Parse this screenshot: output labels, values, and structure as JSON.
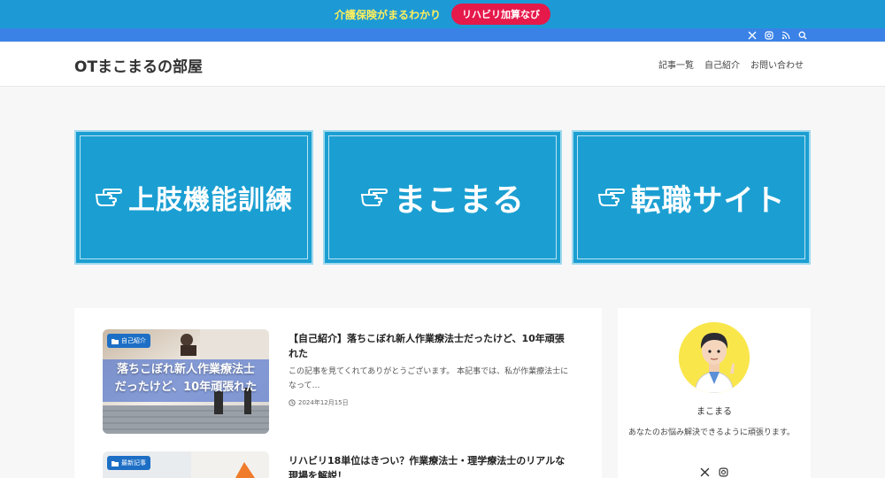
{
  "notice": {
    "text": "介護保険がまるわかり",
    "button": "リハビリ加算なび"
  },
  "topbar": {
    "icons": [
      "x-icon",
      "instagram-icon",
      "rss-icon",
      "search-icon"
    ]
  },
  "header": {
    "site_title": "OTまこまるの部屋",
    "nav": [
      "記事一覧",
      "自己紹介",
      "お問い合わせ"
    ]
  },
  "banners": [
    {
      "label": "上肢機能訓練",
      "icon": "pointing-hand-icon"
    },
    {
      "label": "まこまる",
      "icon": "pointing-hand-icon"
    },
    {
      "label": "転職サイト",
      "icon": "pointing-hand-icon"
    }
  ],
  "posts": [
    {
      "category": "自己紹介",
      "thumb_text": [
        "落ちこぼれ新人作業療法士",
        "だったけど、10年頑張れた"
      ],
      "title": "【自己紹介】落ちこぼれ新人作業療法士だったけど、10年頑張れた",
      "excerpt": "この記事を見てくれてありがとうございます。 本記事では、私が作業療法士になって…",
      "date": "2024年12月15日"
    },
    {
      "category": "最新記事",
      "title": "リハビリ18単位はきつい？作業療法士・理学療法士のリアルな現場を解説！"
    }
  ],
  "profile": {
    "name": "まこまる",
    "description": "あなたのお悩み解決できるように頑張ります。",
    "icons": [
      "x-icon",
      "instagram-icon"
    ]
  },
  "colors": {
    "accent": "#1b9fd2",
    "notice_bg": "#1d9ad6",
    "notice_text": "#ffef5c",
    "button_bg": "#e6194b",
    "topbar": "#3b82e6",
    "category_badge": "#1d6fc5"
  }
}
